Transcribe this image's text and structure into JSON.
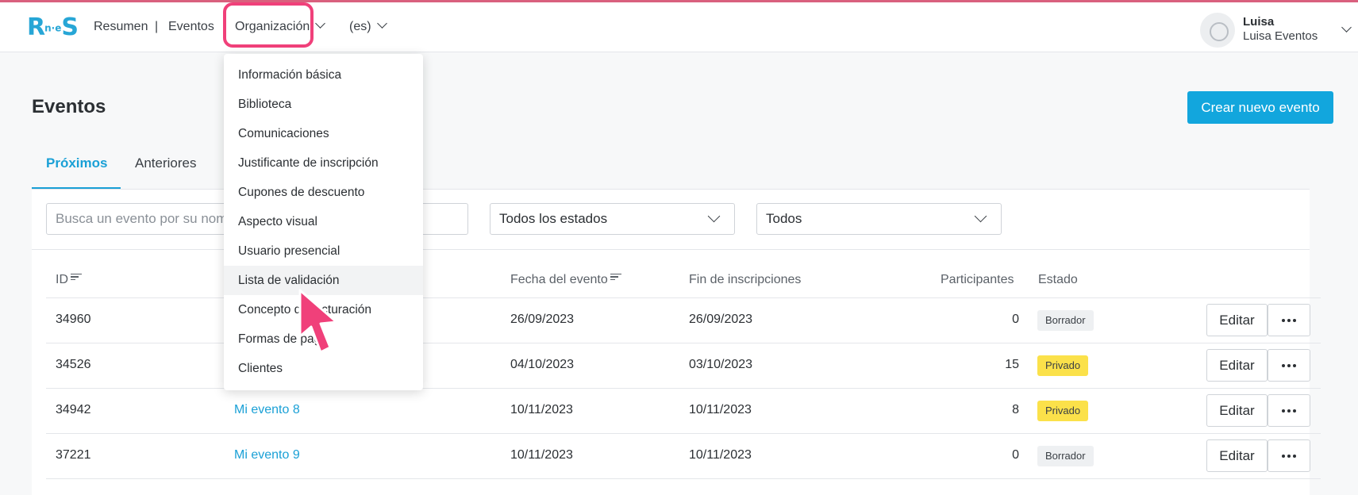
{
  "header": {
    "logo_text": "R",
    "logo_mini": "n·e",
    "logo_tail": "S",
    "nav": [
      "Resumen",
      "|",
      "Eventos",
      "Organización",
      "(es)"
    ],
    "user": {
      "name": "Luisa",
      "subtitle": "Luisa Eventos"
    }
  },
  "page": {
    "title": "Eventos",
    "create_button": "Crear nuevo evento",
    "tabs": [
      "Próximos",
      "Anteriores"
    ],
    "filters": {
      "search_placeholder": "Busca un evento por su nombre",
      "status_select": "Todos los estados",
      "type_select": "Todos"
    }
  },
  "dropdown": {
    "items": [
      "Información básica",
      "Biblioteca",
      "Comunicaciones",
      "Justificante de inscripción",
      "Cupones de descuento",
      "Aspecto visual",
      "Usuario presencial",
      "Lista de validación",
      "Concepto de facturación",
      "Formas de pago",
      "Clientes"
    ],
    "hovered_index": 7
  },
  "table": {
    "columns": [
      "ID",
      "Fecha del evento",
      "Fin de inscripciones",
      "Participantes",
      "Estado"
    ],
    "rows": [
      {
        "id": "34960",
        "name": "",
        "fecha": "26/09/2023",
        "fin": "26/09/2023",
        "participantes": "0",
        "estado": "Borrador",
        "edit": "Editar"
      },
      {
        "id": "34526",
        "name": "",
        "fecha": "04/10/2023",
        "fin": "03/10/2023",
        "participantes": "15",
        "estado": "Privado",
        "edit": "Editar"
      },
      {
        "id": "34942",
        "name": "Mi evento 8",
        "fecha": "10/11/2023",
        "fin": "10/11/2023",
        "participantes": "8",
        "estado": "Privado",
        "edit": "Editar"
      },
      {
        "id": "37221",
        "name": "Mi evento 9",
        "fecha": "10/11/2023",
        "fin": "10/11/2023",
        "participantes": "0",
        "estado": "Borrador",
        "edit": "Editar"
      }
    ]
  },
  "colors": {
    "accent": "#12a6dd",
    "highlight": "#f0407a",
    "badge_private": "#fbe14a"
  }
}
